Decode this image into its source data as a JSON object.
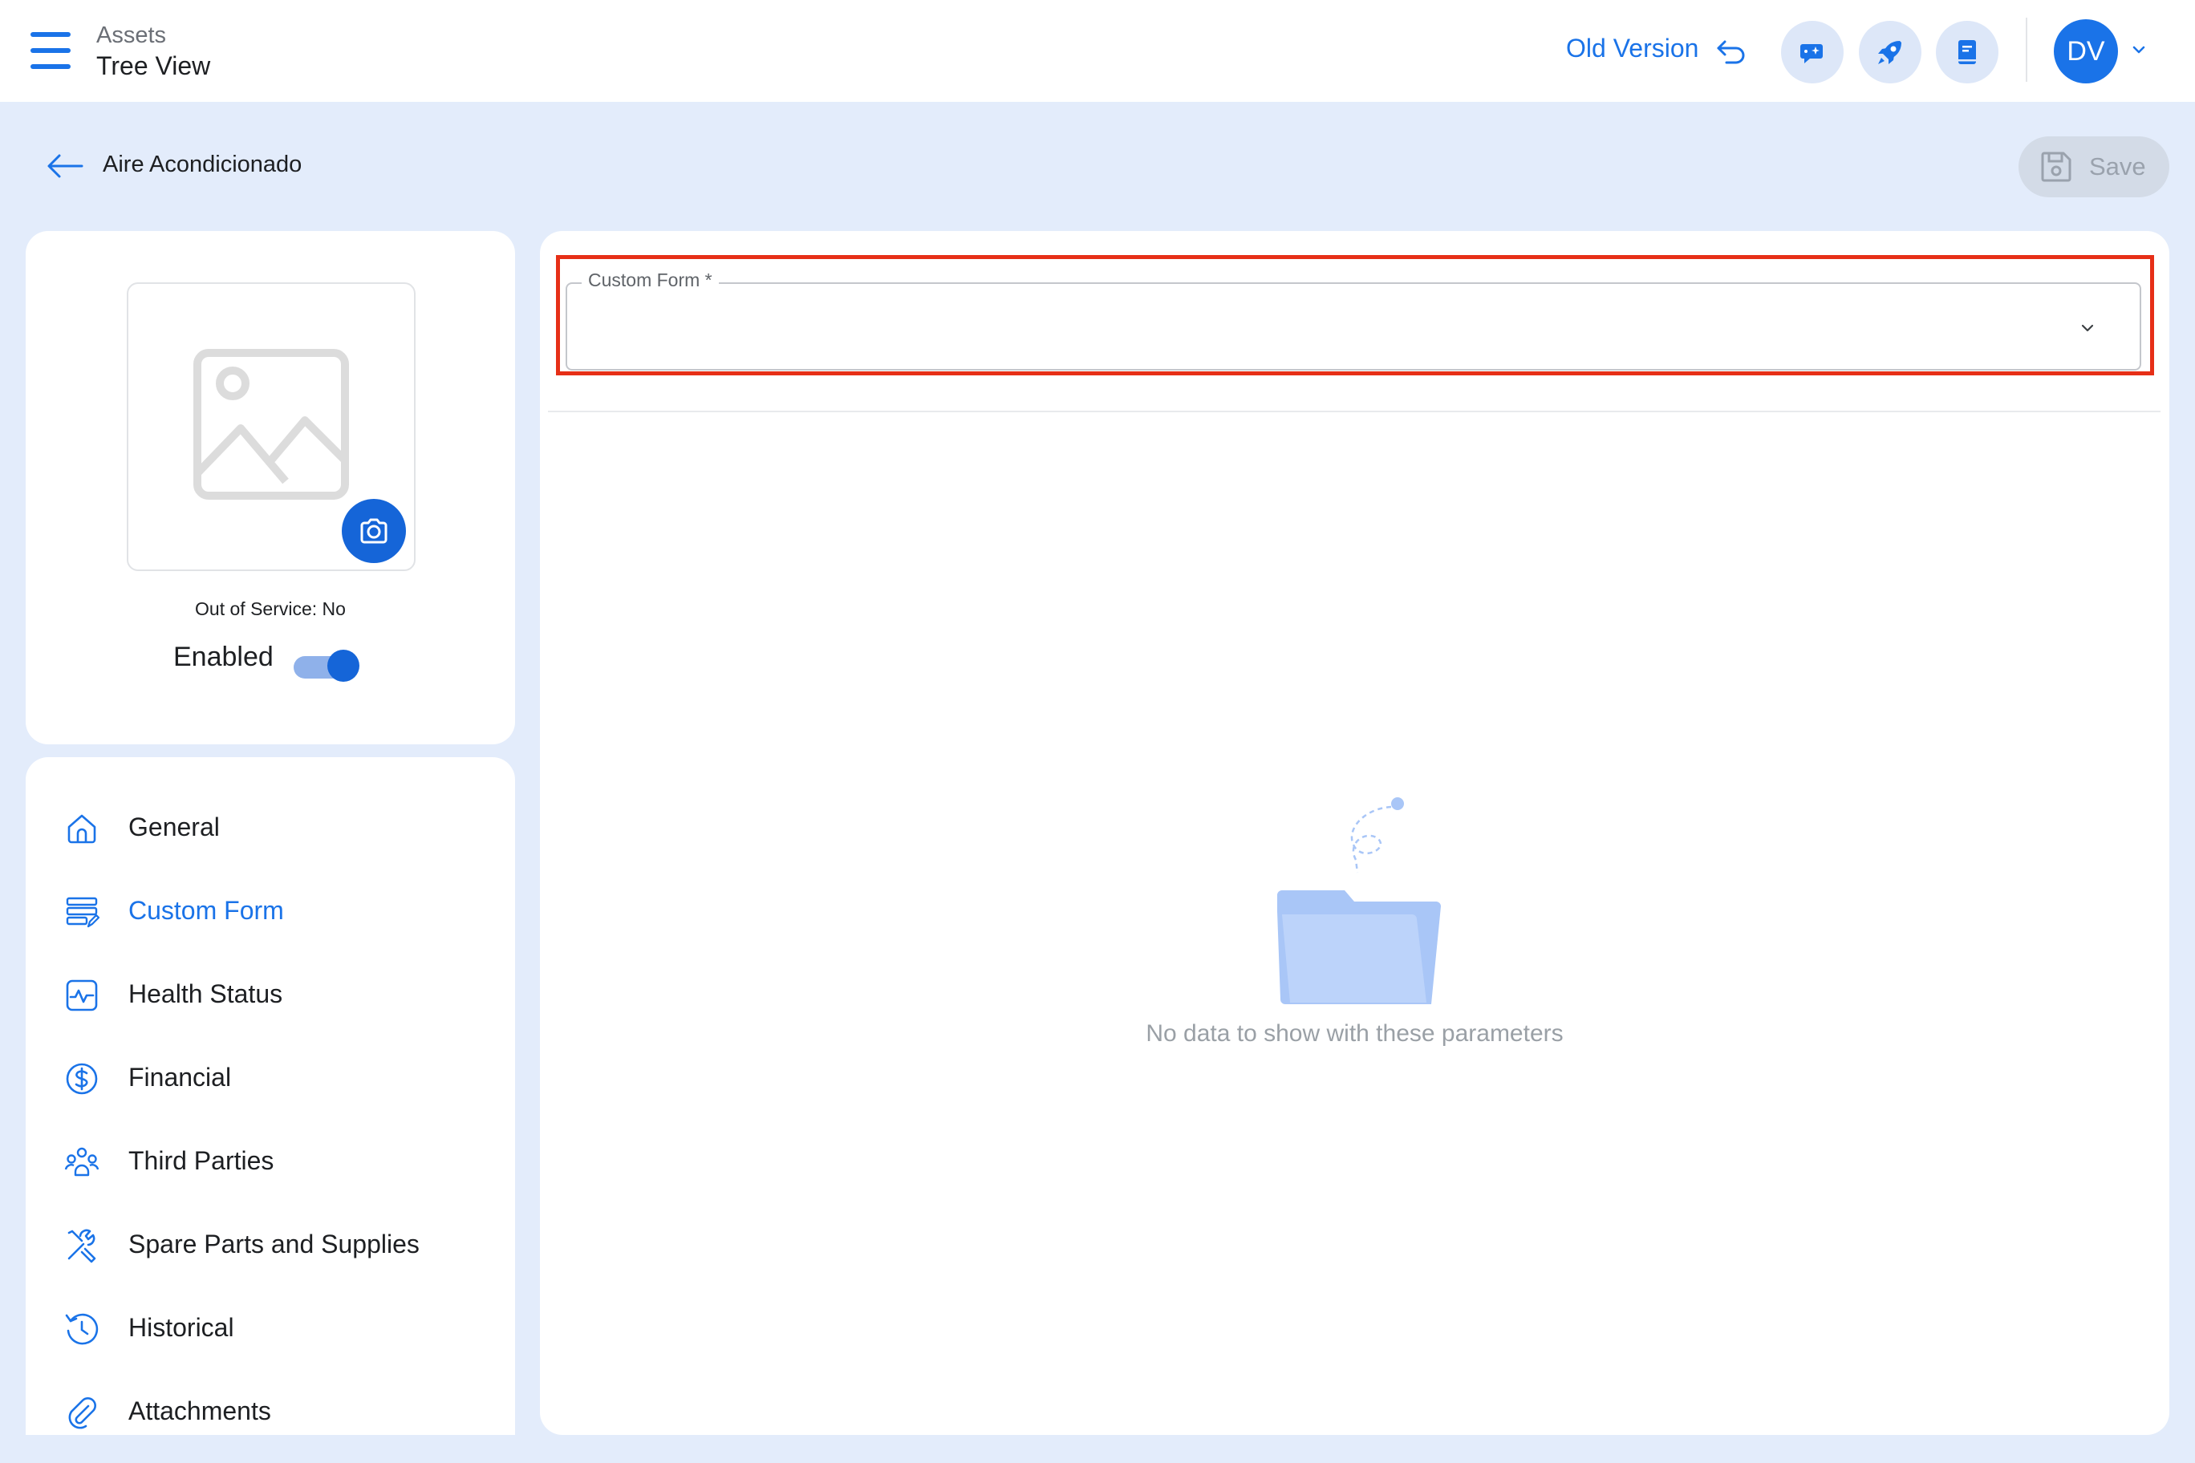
{
  "header": {
    "breadcrumb_parent": "Assets",
    "breadcrumb_current": "Tree View",
    "old_version_label": "Old Version",
    "user_initials": "DV",
    "icons": [
      "menu-icon",
      "undo-icon",
      "chat-sparkle-icon",
      "rocket-icon",
      "book-icon",
      "chevron-down-icon"
    ]
  },
  "asset": {
    "title": "Aire Acondicionado",
    "save_label": "Save",
    "out_of_service": "Out of Service: No",
    "enabled_label": "Enabled",
    "enabled": true
  },
  "nav": {
    "items": [
      {
        "label": "General",
        "icon": "home-icon"
      },
      {
        "label": "Custom Form",
        "icon": "form-icon",
        "active": true
      },
      {
        "label": "Health Status",
        "icon": "pulse-icon"
      },
      {
        "label": "Financial",
        "icon": "dollar-icon"
      },
      {
        "label": "Third Parties",
        "icon": "people-icon"
      },
      {
        "label": "Spare Parts and Supplies",
        "icon": "tools-icon"
      },
      {
        "label": "Historical",
        "icon": "history-icon"
      },
      {
        "label": "Attachments",
        "icon": "paperclip-icon"
      }
    ]
  },
  "main": {
    "custom_form_label": "Custom Form *",
    "custom_form_value": "",
    "empty_message": "No data to show with these parameters"
  },
  "colors": {
    "accent": "#1a73e8",
    "background": "#e3ecfb",
    "highlight": "#e62f17"
  }
}
